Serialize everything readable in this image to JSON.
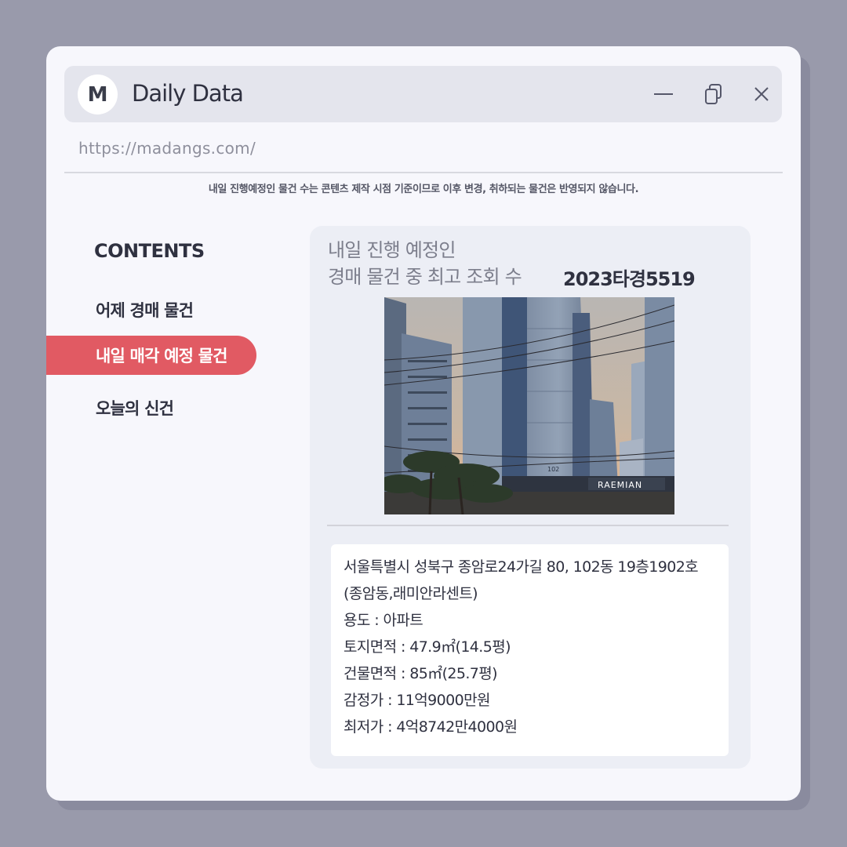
{
  "window": {
    "logo_letter": "M",
    "title": "Daily Data",
    "controls": [
      "minimize-icon",
      "restore-icon",
      "close-icon"
    ]
  },
  "url": "https://madangs.com/",
  "notice": "내일 진행예정인 물건 수는 콘텐츠 제작 시점 기준이므로 이후 변경, 취하되는 물건은 반영되지 않습니다.",
  "sidebar": {
    "title": "CONTENTS",
    "items": [
      {
        "label": "어제 경매 물건",
        "active": false
      },
      {
        "label": "내일 매각 예정 물건",
        "active": true
      },
      {
        "label": "오늘의 신건",
        "active": false
      }
    ]
  },
  "card": {
    "heading_line1": "내일 진행 예정인",
    "heading_line2": "경매 물건 중 최고 조회 수",
    "case_number": "2023타경5519",
    "photo": {
      "building_number": "102",
      "sign_text": "RAEMIAN"
    },
    "details": [
      "서울특별시 성북구 종암로24가길 80, 102동 19층1902호",
      "(종암동,래미안라센트)",
      "용도 : 아파트",
      "토지면적 : 47.9㎡(14.5평)",
      "건물면적 : 85㎡(25.7평)",
      "감정가 : 11억9000만원",
      "최저가 : 4억8742만4000원"
    ]
  },
  "colors": {
    "background": "#999aab",
    "window": "#f7f7fc",
    "titlebar": "#e4e5ed",
    "accent": "#e15a63",
    "card": "#eceef5"
  }
}
